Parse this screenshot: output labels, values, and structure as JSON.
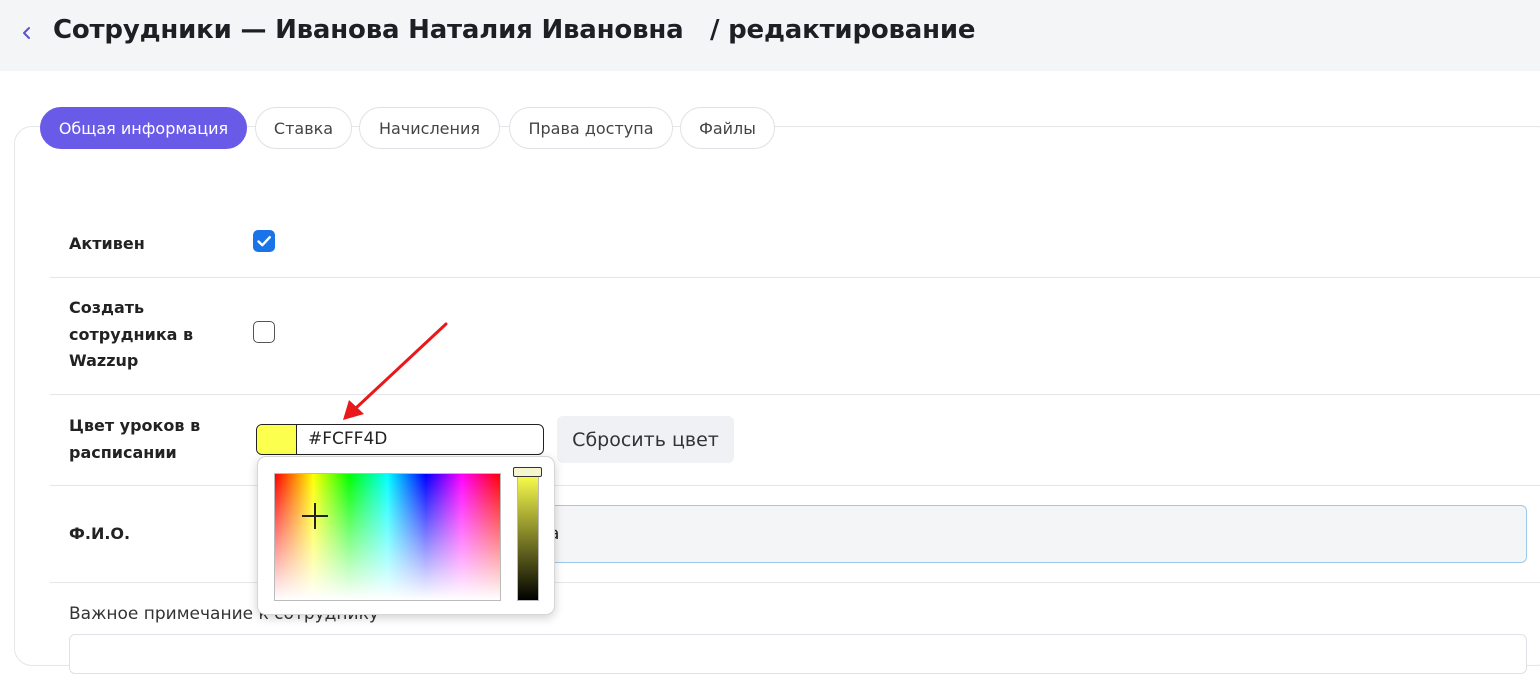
{
  "header": {
    "title": "Сотрудники — Иванова Наталия Ивановна   / редактирование"
  },
  "tabs": [
    {
      "label": "Общая информация",
      "active": true
    },
    {
      "label": "Ставка",
      "active": false
    },
    {
      "label": "Начисления",
      "active": false
    },
    {
      "label": "Права доступа",
      "active": false
    },
    {
      "label": "Файлы",
      "active": false
    }
  ],
  "form": {
    "active": {
      "label": "Активен",
      "checked": true
    },
    "wazzup": {
      "label": "Создать\nсотрудника в\nWazzup",
      "checked": false
    },
    "lesson_color": {
      "label": "Цвет уроков в\nрасписании",
      "value": "#FCFF4D",
      "reset_label": "Сбросить цвет"
    },
    "fio": {
      "label": "Ф.И.О.",
      "value_visible_tail": "а"
    },
    "note": {
      "label": "Важное примечание к сотруднику"
    }
  },
  "colors": {
    "accent": "#6a5ae8",
    "checkbox": "#1a73e8",
    "selected_color": "#fcff4d",
    "arrow": "#e8181b"
  },
  "icons": {
    "back": "chevron-left-icon"
  }
}
